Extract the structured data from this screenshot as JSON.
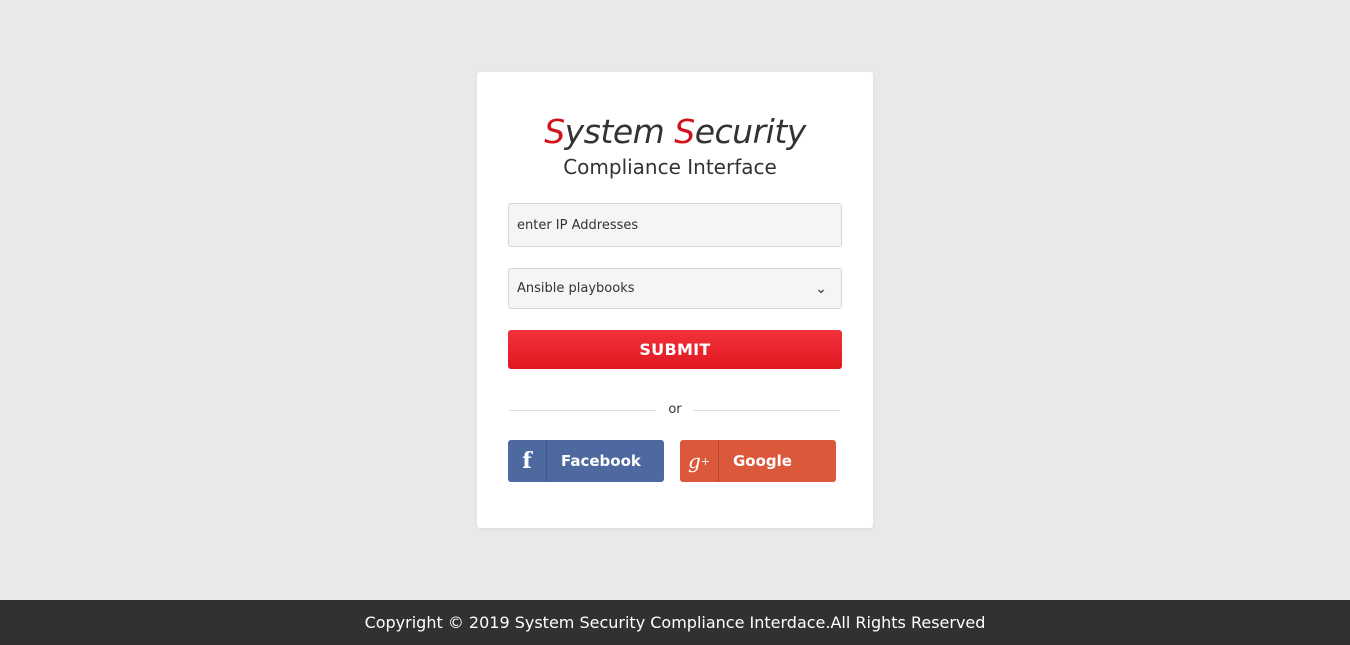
{
  "header": {
    "title_s1": "S",
    "title_ystem": "ystem ",
    "title_s2": "S",
    "title_ecurity": "ecurity",
    "subtitle": "Compliance Interface"
  },
  "form": {
    "ip_placeholder": "enter IP Addresses",
    "select_value": "Ansible playbooks",
    "submit_label": "SUBMIT",
    "or_text": "or"
  },
  "social": {
    "facebook": {
      "label": "Facebook",
      "icon": "facebook-icon",
      "color": "#4e68a0"
    },
    "google": {
      "label": "Google",
      "icon": "google-plus-icon",
      "color": "#dc583b"
    }
  },
  "footer": {
    "copyright": "Copyright © 2019 System Security Compliance Interdace.All Rights Reserved"
  },
  "colors": {
    "accent": "#d0121b",
    "submit": "#e01820",
    "footer_bg": "#313131",
    "page_bg": "#e9e9e9"
  }
}
